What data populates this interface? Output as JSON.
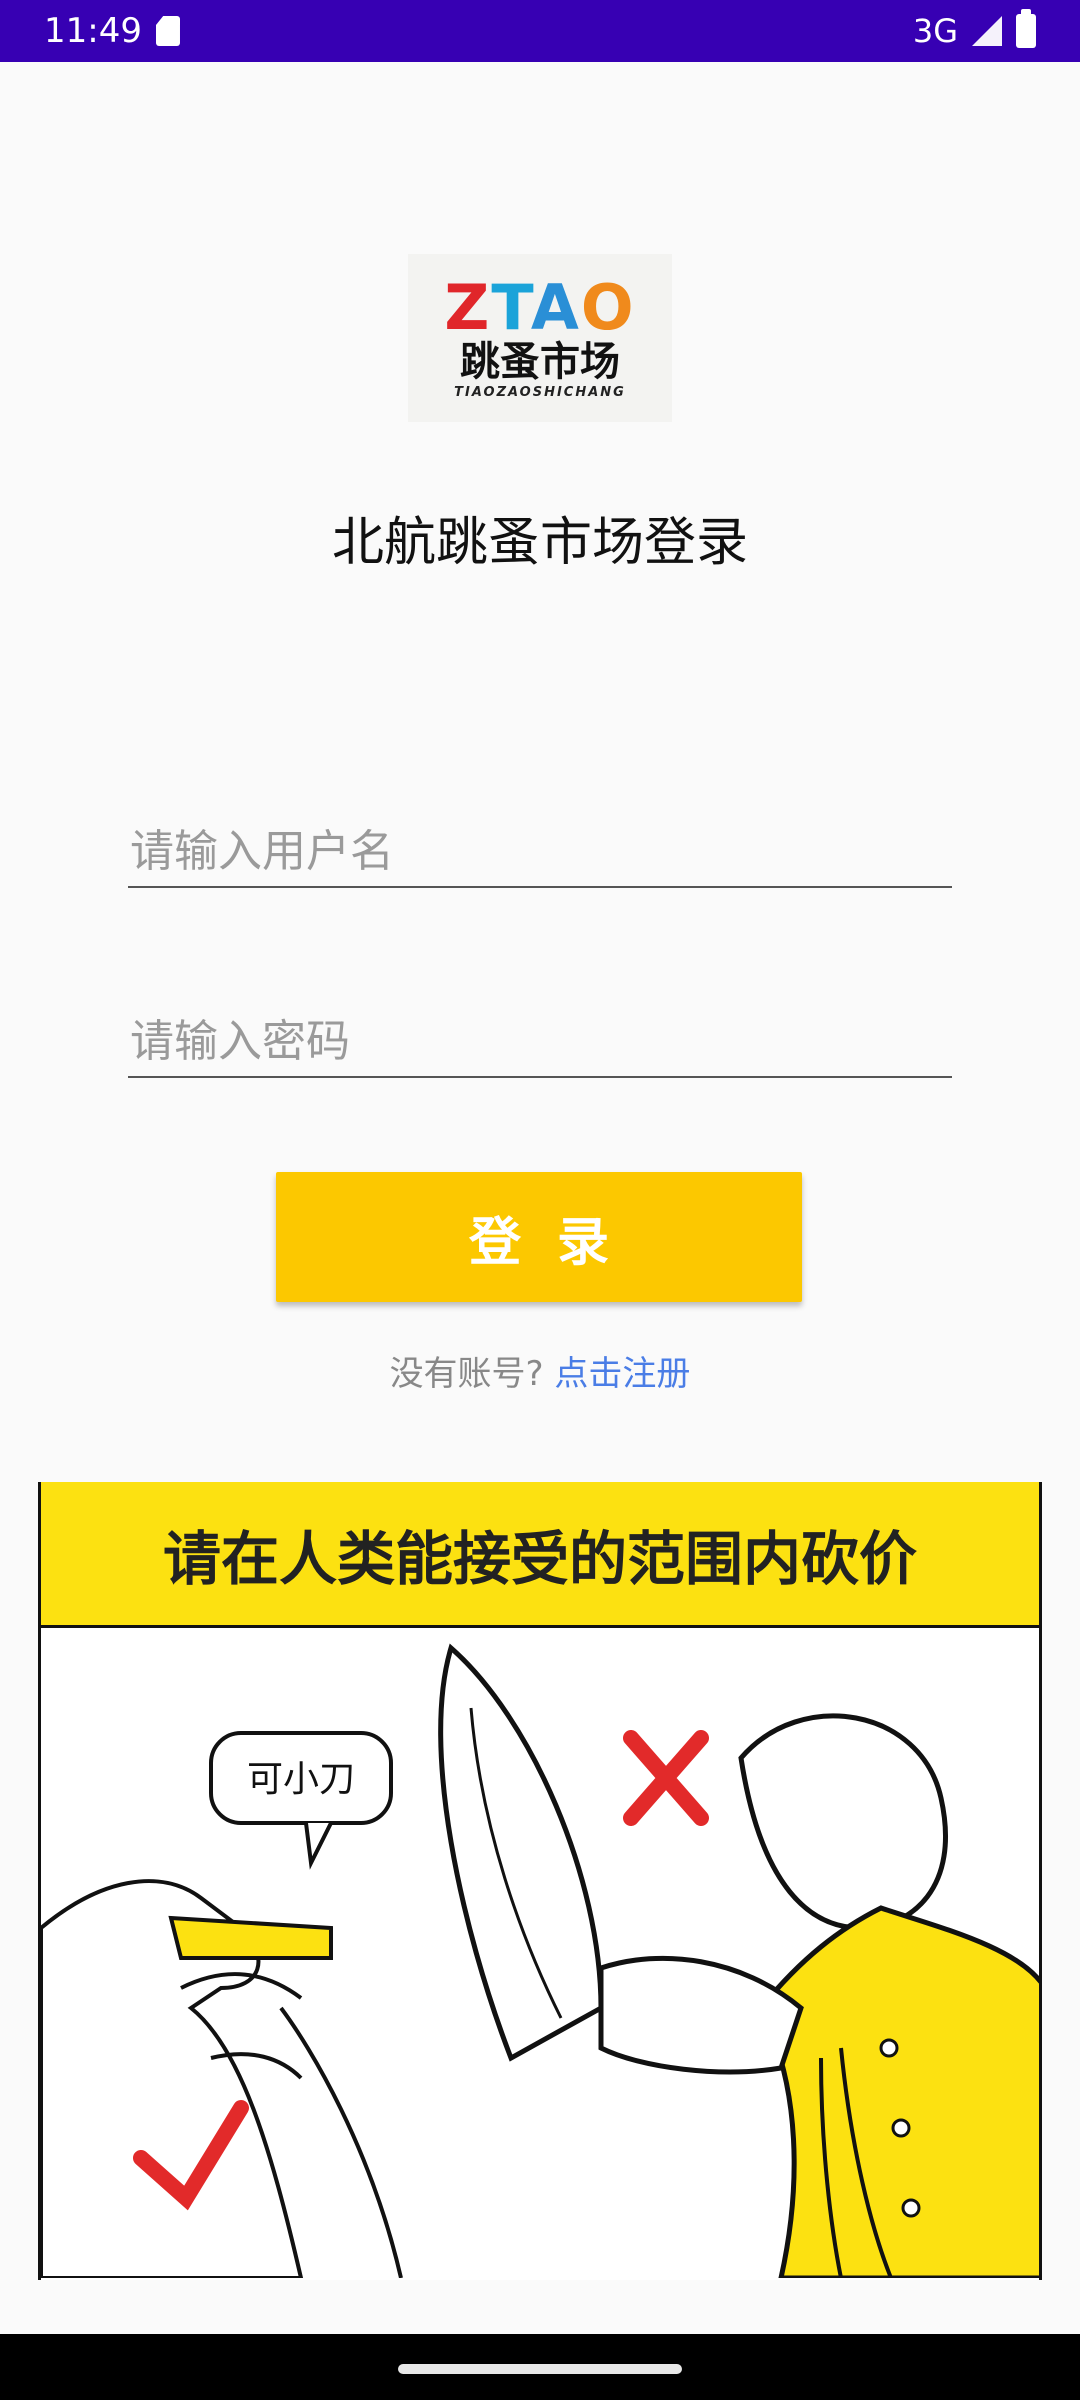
{
  "status_bar": {
    "time": "11:49",
    "network": "3G",
    "icons": [
      "sd-card-icon",
      "signal-icon",
      "battery-icon"
    ]
  },
  "logo": {
    "letters": [
      "Z",
      "T",
      "A",
      "O"
    ],
    "chinese": "跳蚤市场",
    "english": "TIAOZAOSHICHANG"
  },
  "title": "北航跳蚤市场登录",
  "form": {
    "username_placeholder": "请输入用户名",
    "password_placeholder": "请输入密码",
    "login_label": "登录"
  },
  "register": {
    "question": "没有账号?",
    "link": "点击注册"
  },
  "banner": {
    "headline": "请在人类能接受的范围内砍价",
    "bubble": "可小刀"
  },
  "colors": {
    "status_bar": "#3700b3",
    "login_button": "#fcc800",
    "link": "#4a7de6",
    "banner_yellow": "#fce111"
  }
}
